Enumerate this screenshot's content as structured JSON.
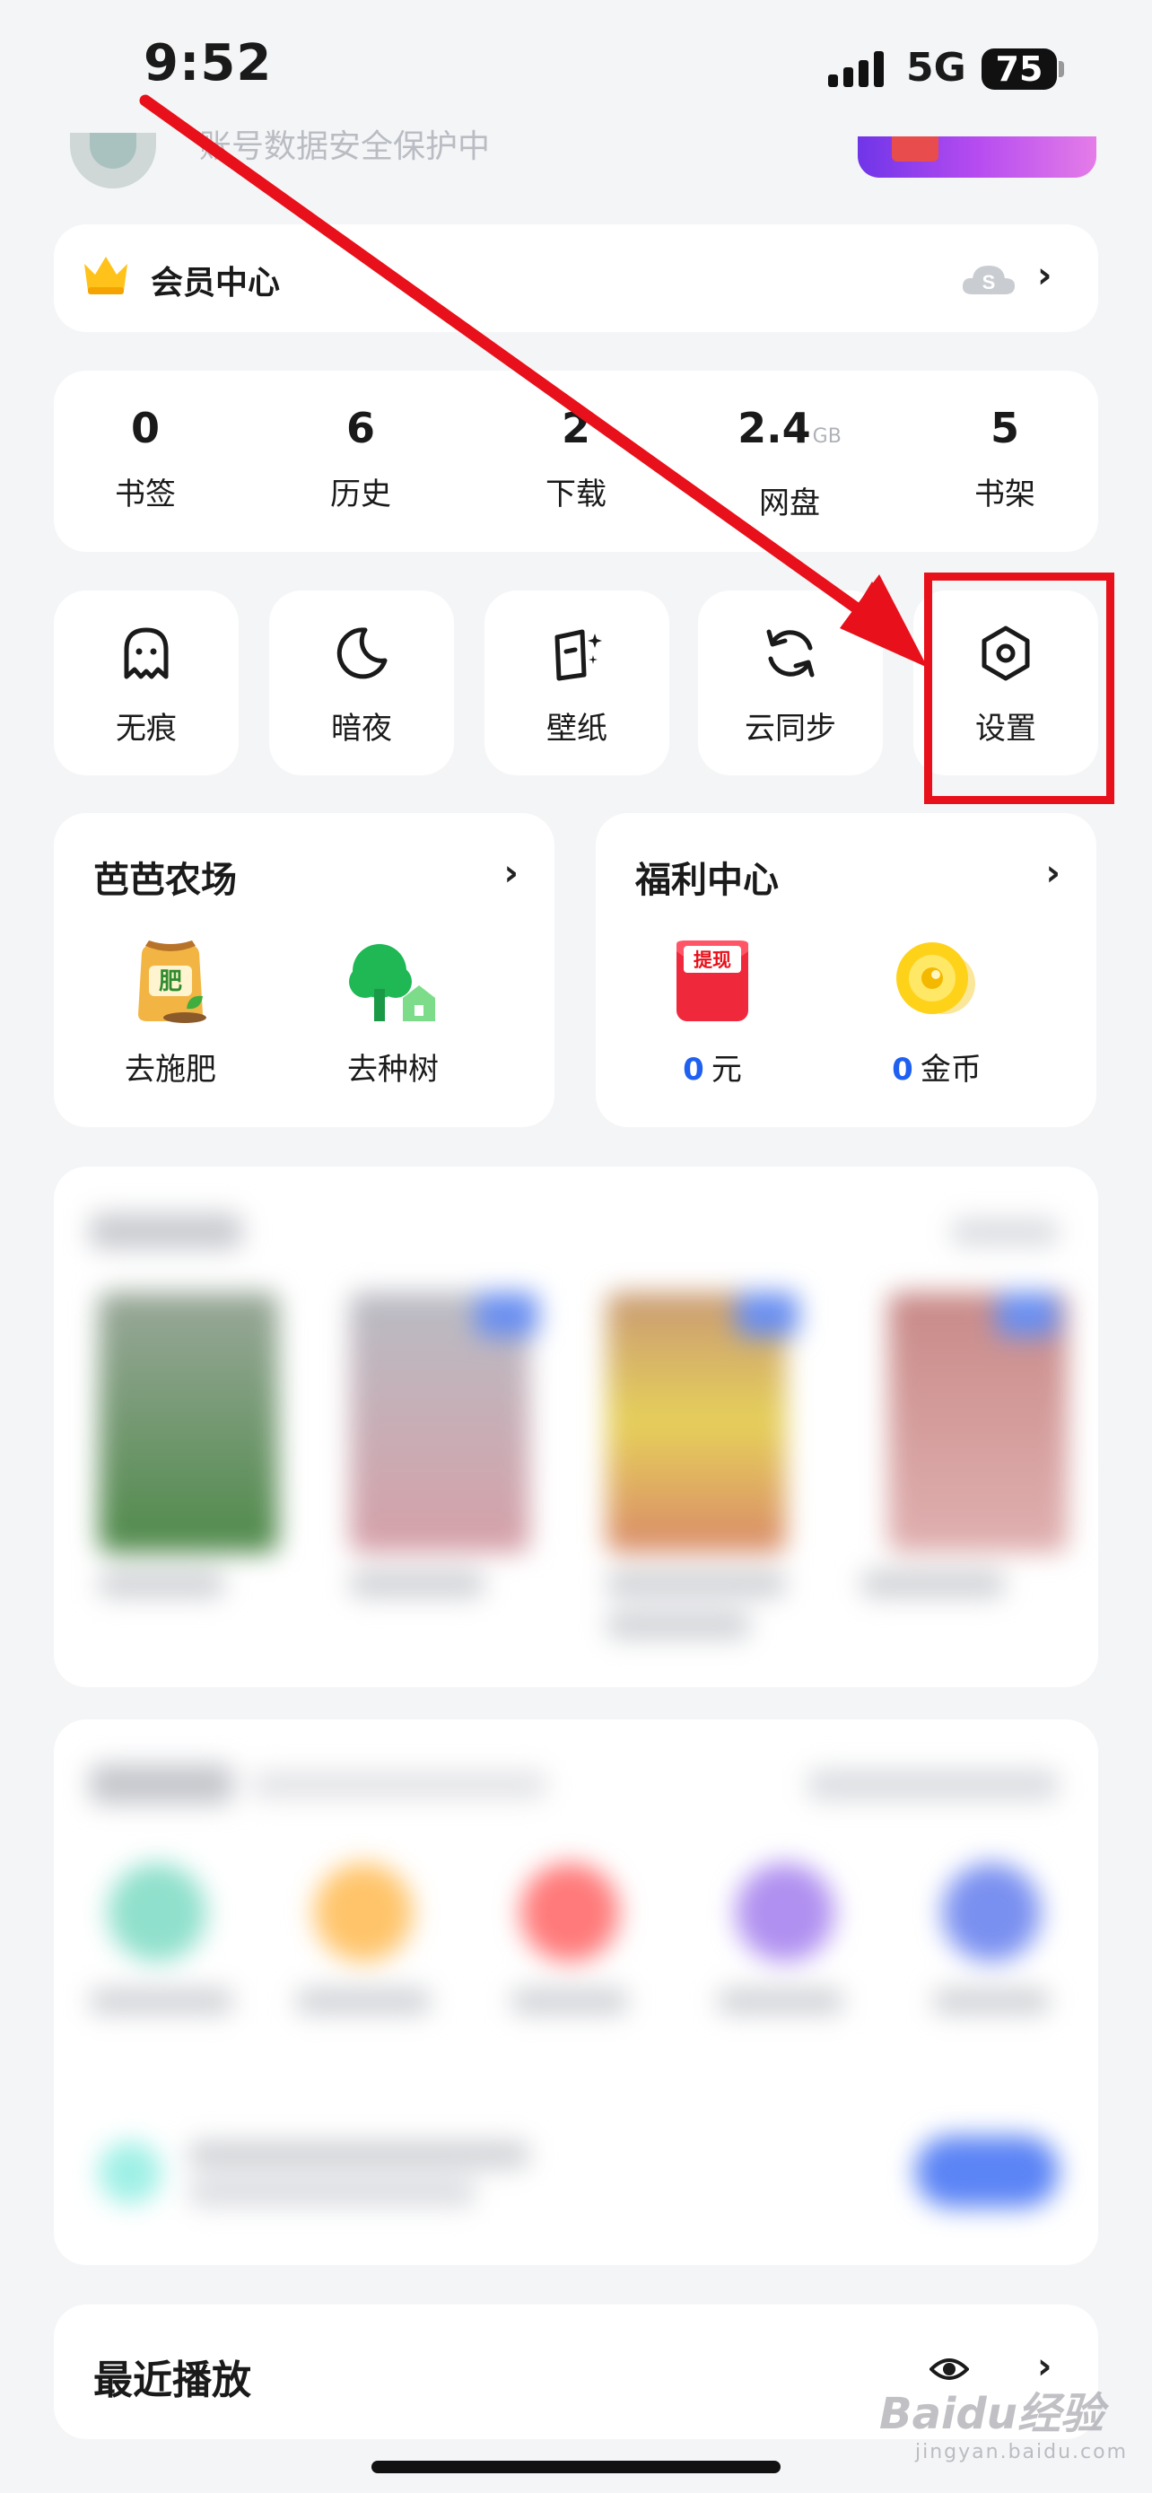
{
  "status_bar": {
    "time": "9:52",
    "network": "5G",
    "battery": "75"
  },
  "profile": {
    "subtitle": "账号数据安全保护中"
  },
  "vip": {
    "label": "会员中心"
  },
  "stats": [
    {
      "value": "0",
      "unit": "",
      "label": "书签"
    },
    {
      "value": "6",
      "unit": "",
      "label": "历史"
    },
    {
      "value": "2",
      "unit": "",
      "label": "下载"
    },
    {
      "value": "2.4",
      "unit": "GB",
      "label": "网盘"
    },
    {
      "value": "5",
      "unit": "",
      "label": "书架"
    }
  ],
  "tools": [
    {
      "label": "无痕",
      "icon": "ghost-icon"
    },
    {
      "label": "暗夜",
      "icon": "moon-icon"
    },
    {
      "label": "壁纸",
      "icon": "wallpaper-icon"
    },
    {
      "label": "云同步",
      "icon": "sync-icon"
    },
    {
      "label": "设置",
      "icon": "settings-hexagon-icon"
    }
  ],
  "farm": {
    "title": "芭芭农场",
    "items": [
      {
        "label": "去施肥",
        "icon": "fertilizer-bag-icon",
        "icon_text": "肥"
      },
      {
        "label": "去种树",
        "icon": "tree-icon"
      }
    ]
  },
  "welfare": {
    "title": "福利中心",
    "items": [
      {
        "amount": "0",
        "label": "元",
        "icon": "red-envelope-icon",
        "icon_text": "提现"
      },
      {
        "amount": "0",
        "label": "金币",
        "icon": "gold-coin-icon"
      }
    ]
  },
  "recent": {
    "title": "最近播放"
  },
  "watermark": {
    "brand": "Baidu经验",
    "domain": "jingyan.baidu.com"
  },
  "colors": {
    "accent_blue": "#2060f0",
    "highlight_red": "#e8101a"
  }
}
